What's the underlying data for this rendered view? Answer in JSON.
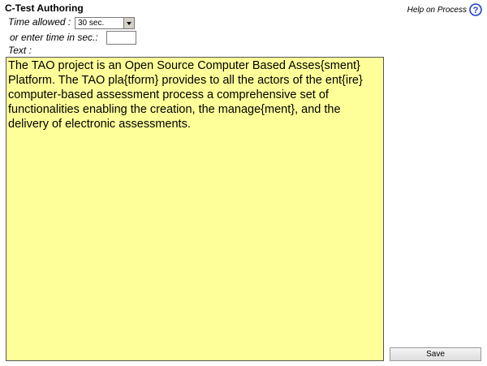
{
  "header": {
    "title": "C-Test Authoring",
    "help_label": "Help on Process",
    "help_icon": "question-circle-icon",
    "help_icon_color": "#1f3fc4"
  },
  "form": {
    "time_allowed_label": "Time allowed :",
    "time_allowed_value": "30 sec.",
    "seconds_label": "or enter time in sec.:",
    "seconds_value": "",
    "text_label": "Text :",
    "text_value": "The TAO project is an Open Source Computer Based Asses{sment}\nPlatform. The TAO pla{tform} provides to all the actors of the ent{ire}\ncomputer-based assessment process a comprehensive set of\nfunctionalities enabling the creation, the manage{ment}, and the\ndelivery of electronic assessments.",
    "text_background": "#ffff99"
  },
  "actions": {
    "save_label": "Save"
  }
}
